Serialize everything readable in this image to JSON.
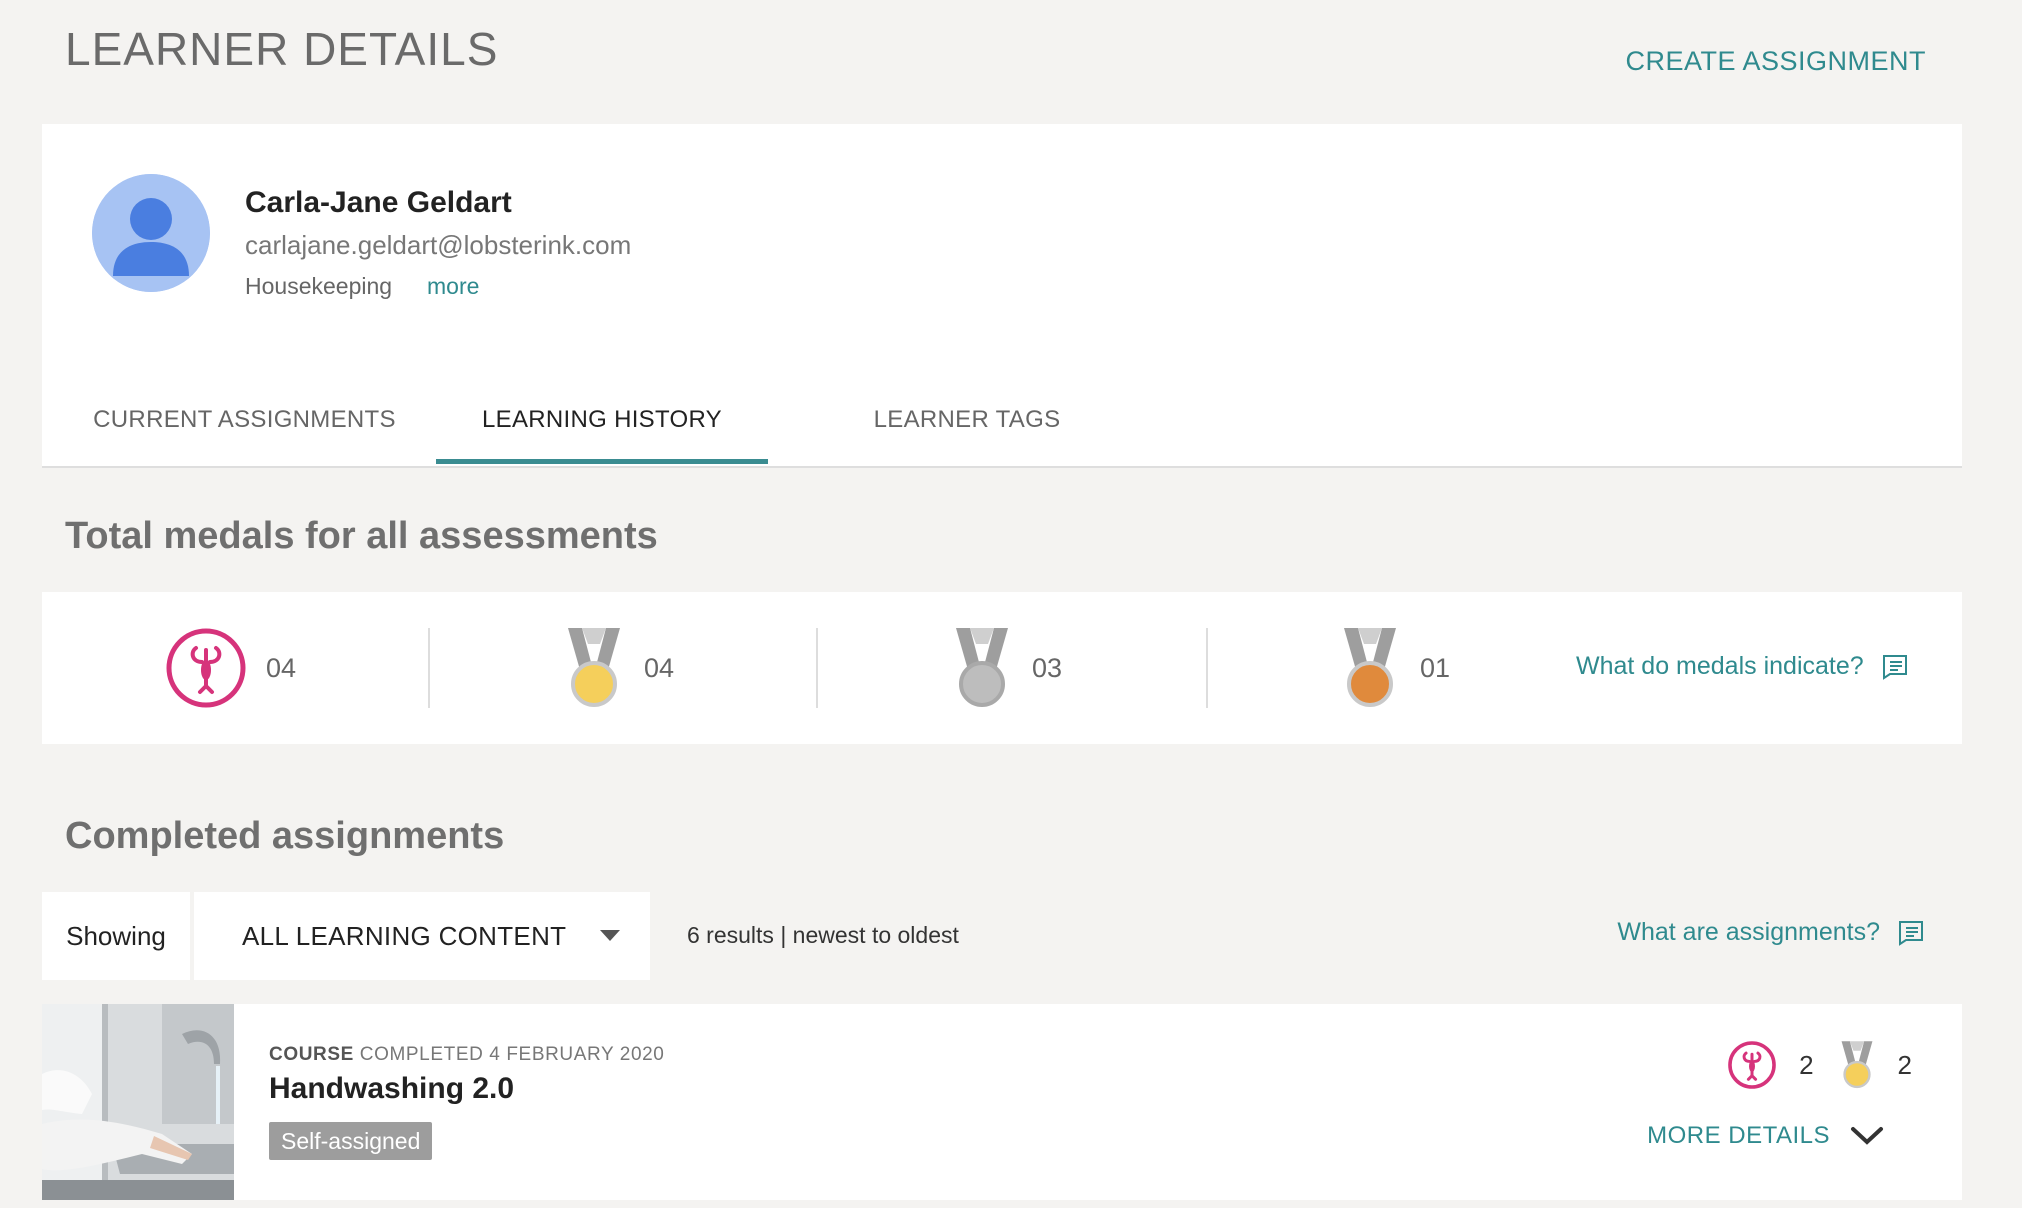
{
  "header": {
    "title": "LEARNER DETAILS",
    "create_label": "CREATE ASSIGNMENT"
  },
  "profile": {
    "name": "Carla-Jane Geldart",
    "email": "carlajane.geldart@lobsterink.com",
    "department": "Housekeeping",
    "more_label": "more"
  },
  "tabs": [
    {
      "label": "CURRENT ASSIGNMENTS",
      "active": false
    },
    {
      "label": "LEARNING HISTORY",
      "active": true
    },
    {
      "label": "LEARNER TAGS",
      "active": false
    }
  ],
  "medals": {
    "title": "Total medals for all assessments",
    "items": [
      {
        "icon": "lobster-medal-icon",
        "count": "04",
        "color": "#d6337b"
      },
      {
        "icon": "gold-medal-icon",
        "count": "04",
        "color": "#f5cf5b"
      },
      {
        "icon": "silver-medal-icon",
        "count": "03",
        "color": "#bdbdbd"
      },
      {
        "icon": "bronze-medal-icon",
        "count": "01",
        "color": "#e08a3c"
      }
    ],
    "help_label": "What do medals indicate?"
  },
  "completed": {
    "title": "Completed assignments",
    "showing_label": "Showing",
    "filter_value": "ALL LEARNING CONTENT",
    "results_text": "6 results | newest to oldest",
    "help_label": "What are assignments?"
  },
  "assignments": [
    {
      "type": "COURSE",
      "status": "COMPLETED 4 FEBRUARY 2020",
      "title": "Handwashing 2.0",
      "badge": "Self-assigned",
      "lobster_count": "2",
      "gold_count": "2",
      "more_label": "MORE DETAILS"
    }
  ],
  "colors": {
    "accent": "#2f8a8e",
    "tab_underline": "#3a8c91",
    "avatar_bg": "#a7c3f3",
    "avatar_fg": "#4a7ee0"
  }
}
